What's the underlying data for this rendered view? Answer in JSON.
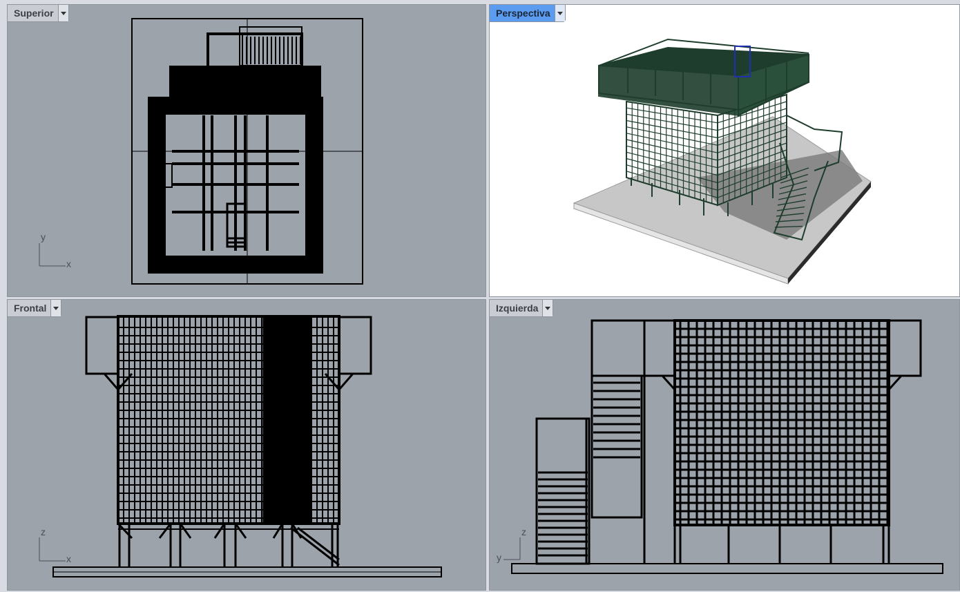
{
  "viewports": {
    "top": {
      "label": "Superior",
      "axis_h": "x",
      "axis_v": "y",
      "active": false
    },
    "perspective": {
      "label": "Perspectiva",
      "active": true
    },
    "front": {
      "label": "Frontal",
      "axis_h": "x",
      "axis_v": "z",
      "active": false
    },
    "left": {
      "label": "Izquierda",
      "axis_h": "y",
      "axis_v": "z",
      "active": false
    }
  },
  "colors": {
    "viewport_bg": "#9da3ab",
    "perspective_bg": "#ffffff",
    "active_tab": "#5b9cf0",
    "structure_green": "#1e3d2c",
    "selected_blue": "#1f2fb0"
  }
}
